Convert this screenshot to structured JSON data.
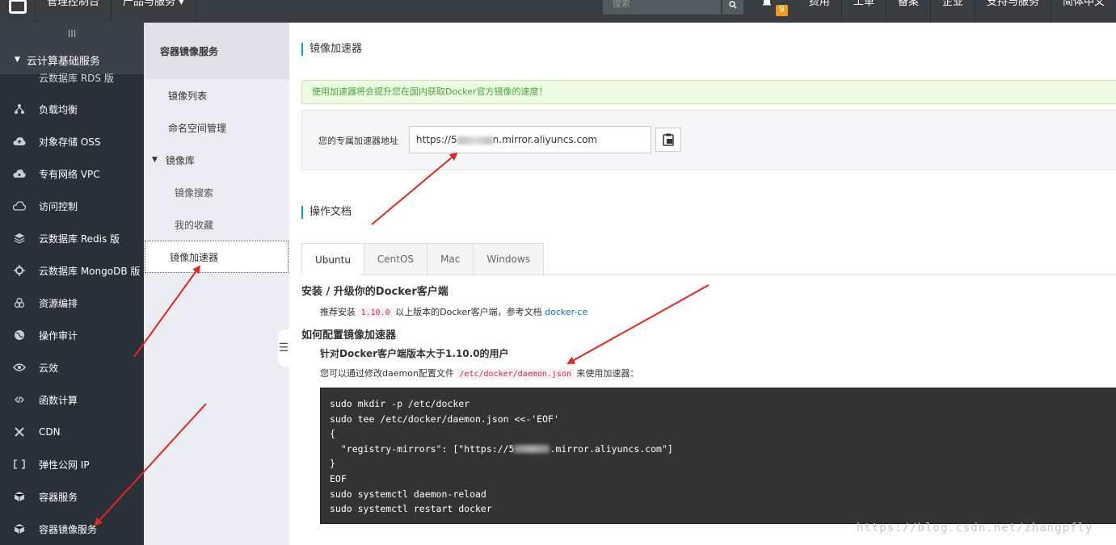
{
  "topbar": {
    "console": "管理控制台",
    "products": "产品与服务",
    "search_placeholder": "搜索",
    "notification_count": "9",
    "right_items": [
      "费用",
      "工单",
      "备案",
      "企业",
      "支持与服务",
      "简体中文"
    ]
  },
  "sidebar": {
    "toggle": "III",
    "section": "云计算基础服务",
    "partial_item": "云数据库 RDS 版",
    "items": [
      {
        "label": "负载均衡",
        "icon": "load-balancer-icon"
      },
      {
        "label": "对象存储 OSS",
        "icon": "cloud-upload-icon"
      },
      {
        "label": "专有网络 VPC",
        "icon": "cloud-network-icon"
      },
      {
        "label": "访问控制",
        "icon": "cloud-icon"
      },
      {
        "label": "云数据库 Redis 版",
        "icon": "layers-icon"
      },
      {
        "label": "云数据库 MongoDB 版",
        "icon": "gear-icon"
      },
      {
        "label": "资源编排",
        "icon": "rings-icon"
      },
      {
        "label": "操作审计",
        "icon": "globe-icon"
      },
      {
        "label": "云效",
        "icon": "eye-icon"
      },
      {
        "label": "函数计算",
        "icon": "function-icon"
      },
      {
        "label": "CDN",
        "icon": "cdn-icon"
      },
      {
        "label": "弹性公网 IP",
        "icon": "eip-icon"
      },
      {
        "label": "容器服务",
        "icon": "cube-icon"
      },
      {
        "label": "容器镜像服务",
        "icon": "cube-icon"
      }
    ]
  },
  "subnav": {
    "title": "容器镜像服务",
    "items": [
      {
        "label": "镜像列表",
        "kind": "item"
      },
      {
        "label": "命名空间管理",
        "kind": "item"
      },
      {
        "label": "镜像库",
        "kind": "group"
      },
      {
        "label": "镜像搜索",
        "kind": "child"
      },
      {
        "label": "我的收藏",
        "kind": "child"
      },
      {
        "label": "镜像加速器",
        "kind": "active"
      }
    ]
  },
  "main": {
    "title": "镜像加速器",
    "notice": "使用加速器将会提升您在国内获取Docker官方镜像的速度！",
    "accel_label": "您的专属加速器地址",
    "accel_prefix": "https://5",
    "accel_suffix": "n.mirror.aliyuncs.com",
    "docs_title": "操作文档",
    "tabs": [
      "Ubuntu",
      "CentOS",
      "Mac",
      "Windows"
    ],
    "install_heading": "安装 / 升级你的Docker客户端",
    "install_pre": "推荐安装 ",
    "install_version": "1.10.0",
    "install_post": " 以上版本的Docker客户端，参考文档 ",
    "install_link": "docker-ce",
    "config_heading": "如何配置镜像加速器",
    "target_heading": "针对Docker客户端版本大于1.10.0的用户",
    "config_pre": "您可以通过修改daemon配置文件 ",
    "config_file": "/etc/docker/daemon.json",
    "config_post": " 来使用加速器：",
    "code_lines": [
      "sudo mkdir -p /etc/docker",
      "sudo tee /etc/docker/daemon.json <<-'EOF'",
      "{",
      "  \"registry-mirrors\": [\"https://5",
      "}",
      "EOF",
      "sudo systemctl daemon-reload",
      "sudo systemctl restart docker"
    ],
    "code_mirror_suffix": ".mirror.aliyuncs.com\"]"
  },
  "watermark": "https://blog.csdn.net/zhangpfly",
  "colors": {
    "topbar": "#373d41",
    "sidebar": "#293038",
    "accent": "#00a2ca",
    "notice_text": "#47a43e",
    "arrow": "#e8251b"
  }
}
